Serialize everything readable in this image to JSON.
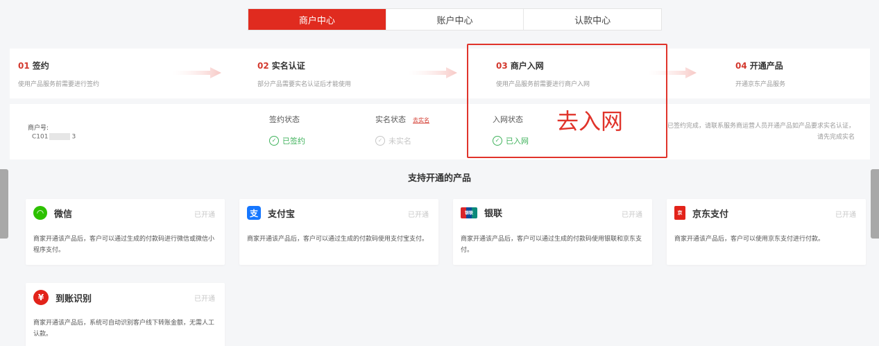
{
  "tabs": [
    {
      "label": "商户中心"
    },
    {
      "label": "账户中心"
    },
    {
      "label": "认款中心"
    }
  ],
  "steps": [
    {
      "num": "01",
      "title": "签约",
      "desc": "使用产品服务前需要进行签约"
    },
    {
      "num": "02",
      "title": "实名认证",
      "desc": "部分产品需要实名认证后才能使用"
    },
    {
      "num": "03",
      "title": "商户入网",
      "desc": "使用产品服务前需要进行商户入网"
    },
    {
      "num": "04",
      "title": "开通产品",
      "desc": "开通京东产品服务"
    }
  ],
  "status": {
    "merchant_label": "商户号:",
    "merchant_id_prefix": "C101",
    "merchant_id_suffix": "3",
    "sign": {
      "label": "签约状态",
      "value": "已签约"
    },
    "realname": {
      "label": "实名状态",
      "link": "去实名",
      "value": "未实名"
    },
    "network": {
      "label": "入网状态",
      "value": "已入网"
    },
    "hint": "已签约完成，请联系服务商运营人员开通产品如产品要求实名认证，请先完成实名"
  },
  "annotation": "去入网",
  "products_title": "支持开通的产品",
  "products": [
    {
      "name": "微信",
      "badge": "已开通",
      "desc": "商家开通该产品后，客户可以通过生成的付款码进行微信或微信小程序支付。",
      "icon": "wechat-icon",
      "color": "#2dc100"
    },
    {
      "name": "支付宝",
      "badge": "已开通",
      "desc": "商家开通该产品后，客户可以通过生成的付款码使用支付宝支付。",
      "icon": "alipay-icon",
      "color": "#1677ff"
    },
    {
      "name": "银联",
      "badge": "已开通",
      "desc": "商家开通该产品后，客户可以通过生成的付款码使用银联和京东支付。",
      "icon": "unionpay-icon",
      "color": "#d9252a"
    },
    {
      "name": "京东支付",
      "badge": "已开通",
      "desc": "商家开通该产品后，客户可以使用京东支付进行付款。",
      "icon": "jdpay-icon",
      "color": "#e2231a"
    },
    {
      "name": "到账识别",
      "badge": "已开通",
      "desc": "商家开通该产品后，系统可自动识别客户线下转账金额，无需人工认款。",
      "icon": "yen-icon",
      "color": "#e2231a"
    }
  ]
}
